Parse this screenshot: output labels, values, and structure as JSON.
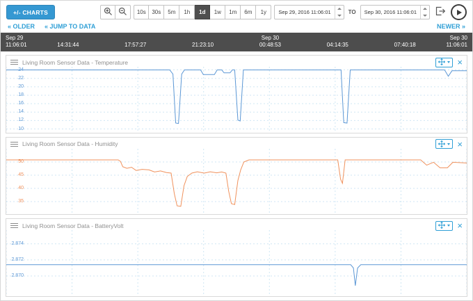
{
  "toolbar": {
    "charts_button": "+/- CHARTS",
    "ranges": [
      "10s",
      "30s",
      "5m",
      "1h",
      "1d",
      "1w",
      "1m",
      "6m",
      "1y"
    ],
    "active_range": "1d",
    "from_value": "Sep 29, 2016 11:06:01",
    "to_label": "TO",
    "to_value": "Sep 30, 2016 11:06:01"
  },
  "nav": {
    "older": "« OLDER",
    "jump_to_data": "« JUMP TO DATA",
    "newer": "NEWER »"
  },
  "timeline": {
    "ticks": [
      {
        "date": "Sep 29",
        "time": "11:06:01"
      },
      {
        "date": "",
        "time": "14:31:44"
      },
      {
        "date": "",
        "time": "17:57:27"
      },
      {
        "date": "",
        "time": "21:23:10"
      },
      {
        "date": "Sep 30",
        "time": "00:48:53"
      },
      {
        "date": "",
        "time": "04:14:35"
      },
      {
        "date": "",
        "time": "07:40:18"
      },
      {
        "date": "Sep 30",
        "time": "11:06:01"
      }
    ]
  },
  "colors": {
    "accent": "#2f9fd6",
    "grid": "#cfe6f4",
    "timeline_bg": "#4d4d4d",
    "temperature_line": "#5b97d5",
    "humidity_line": "#f0915c",
    "battery_line": "#5b97d5"
  },
  "chart_data": [
    {
      "type": "line",
      "title": "Living Room Sensor Data - Temperature",
      "color": "#5b97d5",
      "xdivs": 7,
      "x_axis": [
        "11:06:01",
        "14:31:44",
        "17:57:27",
        "21:23:10",
        "00:48:53",
        "04:14:35",
        "07:40:18",
        "11:06:01"
      ],
      "yticks": [
        24,
        22,
        20,
        18,
        16,
        14,
        12,
        10
      ],
      "yticklabels": [
        "24",
        "22",
        "20",
        "18",
        "16",
        "14",
        "12",
        "10"
      ],
      "yrange": [
        9.1,
        24.75
      ],
      "points": [
        [
          0,
          24
        ],
        [
          0.355,
          24
        ],
        [
          0.362,
          23
        ],
        [
          0.368,
          11.4
        ],
        [
          0.374,
          11.3
        ],
        [
          0.381,
          23
        ],
        [
          0.387,
          24
        ],
        [
          0.422,
          24
        ],
        [
          0.428,
          22.9
        ],
        [
          0.452,
          22.9
        ],
        [
          0.458,
          24
        ],
        [
          0.468,
          24
        ],
        [
          0.473,
          23.3
        ],
        [
          0.486,
          23.3
        ],
        [
          0.491,
          24
        ],
        [
          0.496,
          24
        ],
        [
          0.503,
          12.1
        ],
        [
          0.508,
          11.9
        ],
        [
          0.515,
          24
        ],
        [
          0.727,
          24
        ],
        [
          0.733,
          11.5
        ],
        [
          0.74,
          11.4
        ],
        [
          0.747,
          24
        ],
        [
          0.952,
          24
        ],
        [
          0.96,
          22.5
        ],
        [
          0.968,
          23.8
        ],
        [
          1,
          23.8
        ]
      ]
    },
    {
      "type": "line",
      "title": "Living Room Sensor Data - Humidity",
      "color": "#f0915c",
      "xdivs": 7,
      "x_axis": [
        "11:06:01",
        "14:31:44",
        "17:57:27",
        "21:23:10",
        "00:48:53",
        "04:14:35",
        "07:40:18",
        "11:06:01"
      ],
      "yticks": [
        50,
        45,
        40,
        35
      ],
      "yticklabels": [
        "50",
        "45",
        "40",
        "35"
      ],
      "yrange": [
        30,
        55
      ],
      "points": [
        [
          0,
          50.8
        ],
        [
          0.243,
          50.8
        ],
        [
          0.248,
          50.2
        ],
        [
          0.253,
          48.2
        ],
        [
          0.262,
          47.6
        ],
        [
          0.272,
          48
        ],
        [
          0.282,
          46.8
        ],
        [
          0.295,
          47.2
        ],
        [
          0.31,
          47
        ],
        [
          0.322,
          46.2
        ],
        [
          0.335,
          46.6
        ],
        [
          0.348,
          46
        ],
        [
          0.358,
          45.8
        ],
        [
          0.365,
          38
        ],
        [
          0.371,
          33.4
        ],
        [
          0.379,
          33.2
        ],
        [
          0.386,
          41
        ],
        [
          0.393,
          44.5
        ],
        [
          0.403,
          45.8
        ],
        [
          0.415,
          46.3
        ],
        [
          0.43,
          45.8
        ],
        [
          0.443,
          46.3
        ],
        [
          0.457,
          45.9
        ],
        [
          0.468,
          46.2
        ],
        [
          0.477,
          45.8
        ],
        [
          0.483,
          39
        ],
        [
          0.489,
          34.2
        ],
        [
          0.496,
          33.9
        ],
        [
          0.503,
          43
        ],
        [
          0.509,
          47
        ],
        [
          0.516,
          50
        ],
        [
          0.527,
          50.8
        ],
        [
          0.7,
          50.8
        ],
        [
          0.72,
          50.8
        ],
        [
          0.726,
          43.5
        ],
        [
          0.73,
          41.9
        ],
        [
          0.736,
          50.8
        ],
        [
          0.9,
          50.8
        ],
        [
          0.913,
          48.8
        ],
        [
          0.928,
          49.9
        ],
        [
          0.942,
          47.8
        ],
        [
          0.958,
          47.8
        ],
        [
          0.97,
          49.9
        ],
        [
          1,
          49.6
        ]
      ]
    },
    {
      "type": "line",
      "title": "Living Room Sensor Data - BatteryVolt",
      "color": "#5b97d5",
      "xdivs": 7,
      "x_axis": [
        "11:06:01",
        "14:31:44",
        "17:57:27",
        "21:23:10",
        "00:48:53",
        "04:14:35",
        "07:40:18",
        "11:06:01"
      ],
      "yticks": [
        2.874,
        2.872,
        2.87
      ],
      "yticklabels": [
        "2.874",
        "2.872",
        "2.870"
      ],
      "yrange": [
        2.8675,
        2.8757
      ],
      "points": [
        [
          0,
          2.8714
        ],
        [
          0.748,
          2.8714
        ],
        [
          0.754,
          2.871
        ],
        [
          0.758,
          2.8688
        ],
        [
          0.763,
          2.871
        ],
        [
          0.77,
          2.8714
        ],
        [
          1,
          2.8714
        ]
      ]
    }
  ]
}
